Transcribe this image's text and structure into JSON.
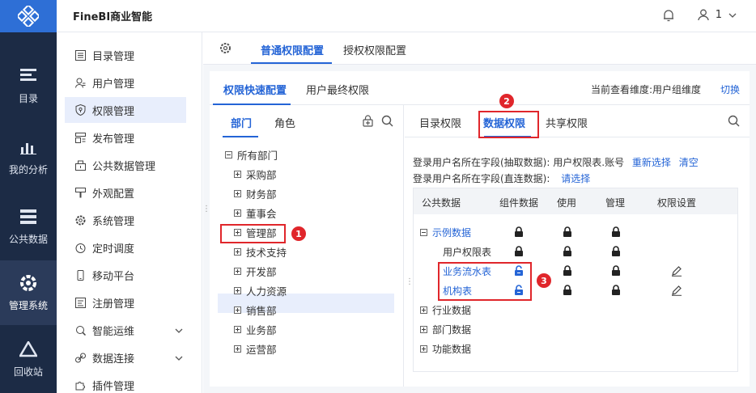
{
  "app": {
    "title": "FineBI商业智能"
  },
  "header": {
    "user_label": "1"
  },
  "leftnav": [
    {
      "label": "目录",
      "icon": "catalog-icon"
    },
    {
      "label": "我的分析",
      "icon": "analysis-icon"
    },
    {
      "label": "公共数据",
      "icon": "database-icon"
    },
    {
      "label": "管理系统",
      "icon": "system-gear-icon"
    },
    {
      "label": "回收站",
      "icon": "recycle-icon"
    }
  ],
  "menu": [
    {
      "label": "目录管理"
    },
    {
      "label": "用户管理"
    },
    {
      "label": "权限管理"
    },
    {
      "label": "发布管理"
    },
    {
      "label": "公共数据管理"
    },
    {
      "label": "外观配置"
    },
    {
      "label": "系统管理"
    },
    {
      "label": "定时调度"
    },
    {
      "label": "移动平台"
    },
    {
      "label": "注册管理"
    },
    {
      "label": "智能运维"
    },
    {
      "label": "数据连接"
    },
    {
      "label": "插件管理"
    }
  ],
  "top_tabs": {
    "normal": "普通权限配置",
    "grant": "授权权限配置"
  },
  "sub_tabs": {
    "quick": "权限快速配置",
    "final": "用户最终权限"
  },
  "dimension": {
    "label": "当前查看维度:用户组维度",
    "switch": "切换"
  },
  "dept_tabs": {
    "dept": "部门",
    "role": "角色"
  },
  "tree": {
    "root": "所有部门",
    "items": [
      "采购部",
      "财务部",
      "董事会",
      "管理部",
      "技术支持",
      "开发部",
      "人力资源",
      "销售部",
      "业务部",
      "运营部"
    ]
  },
  "perm_tabs": {
    "catalog": "目录权限",
    "data": "数据权限",
    "share": "共享权限"
  },
  "fields": {
    "extract_label": "登录用户名所在字段(抽取数据):",
    "extract_value": "用户权限表.账号",
    "reselect": "重新选择",
    "clear": "清空",
    "direct_label": "登录用户名所在字段(直连数据):",
    "choose": "请选择"
  },
  "grid": {
    "headers": [
      "公共数据",
      "组件数据",
      "使用",
      "管理",
      "权限设置"
    ],
    "rows": [
      "示例数据",
      "用户权限表",
      "业务流水表",
      "机构表",
      "行业数据",
      "部门数据",
      "功能数据"
    ]
  },
  "badges": [
    "1",
    "2",
    "3"
  ],
  "colors": {
    "accent": "#2464d6",
    "nav_bg": "#1c2b45",
    "marker": "#e0262b"
  }
}
